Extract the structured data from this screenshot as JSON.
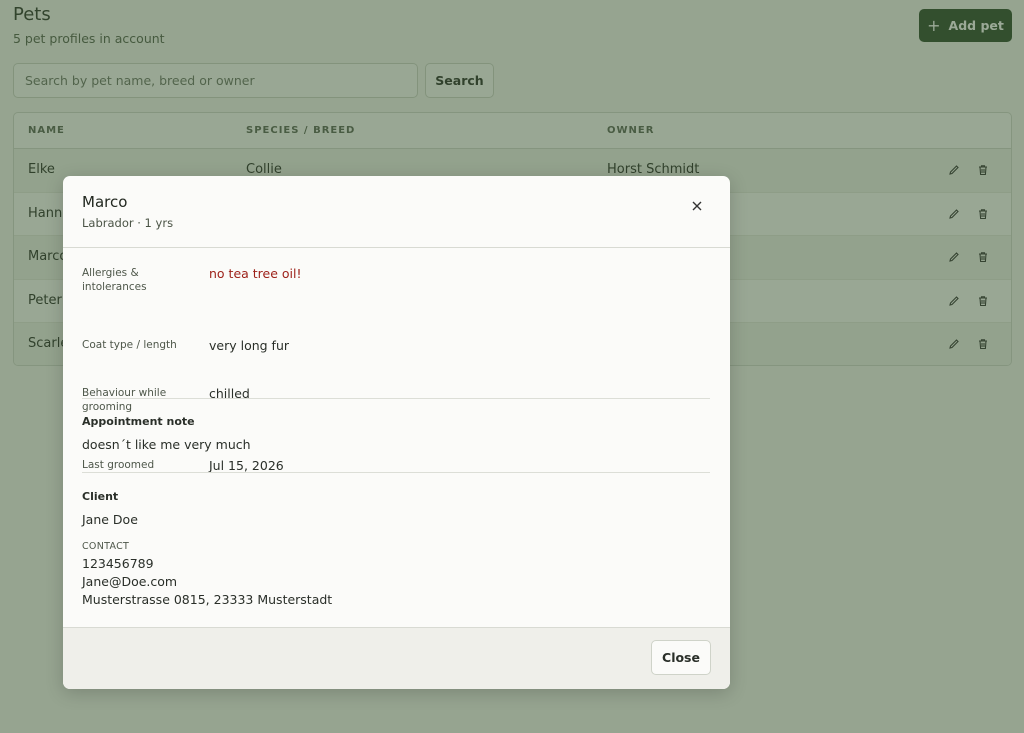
{
  "header": {
    "title": "Pets",
    "subtitle": "5 pet profiles in account",
    "add_label": "Add pet"
  },
  "search": {
    "placeholder": "Search by pet name, breed or owner",
    "value": "",
    "button_label": "Search"
  },
  "table": {
    "columns": [
      "NAME",
      "SPECIES / BREED",
      "OWNER"
    ],
    "rows": [
      {
        "name": "Elke",
        "breed": "Collie",
        "owner": "Horst Schmidt"
      },
      {
        "name": "Hanne",
        "breed": "",
        "owner": ""
      },
      {
        "name": "Marco",
        "breed": "",
        "owner": ""
      },
      {
        "name": "Peter",
        "breed": "",
        "owner": ""
      },
      {
        "name": "Scarle",
        "breed": "",
        "owner": ""
      }
    ]
  },
  "modal": {
    "title": "Marco",
    "subtitle": "Labrador · 1 yrs",
    "details": [
      {
        "label": "Allergies & intolerances",
        "value": "no tea tree oil!"
      },
      {
        "label": "Coat type / length",
        "value": "very long fur"
      },
      {
        "label": "Behaviour while grooming",
        "value": "chilled"
      },
      {
        "label": "Last groomed",
        "value": "Jul 15, 2026"
      }
    ],
    "note_label": "Appointment note",
    "note_text": "doesn´t like me very much",
    "client_label": "Client",
    "client_name": "Jane Doe",
    "contact_label": "CONTACT",
    "phone": "123456789",
    "email": "Jane@Doe.com",
    "address": "Musterstrasse 0815, 23333 Musterstadt",
    "close_label": "Close"
  },
  "colors": {
    "accent": "#2e4b2c",
    "alert": "#9c1f17",
    "overlay": "#385430"
  },
  "icons": {
    "add": "plus-icon",
    "edit": "pencil-icon",
    "delete": "trash-icon",
    "close": "close-icon"
  }
}
